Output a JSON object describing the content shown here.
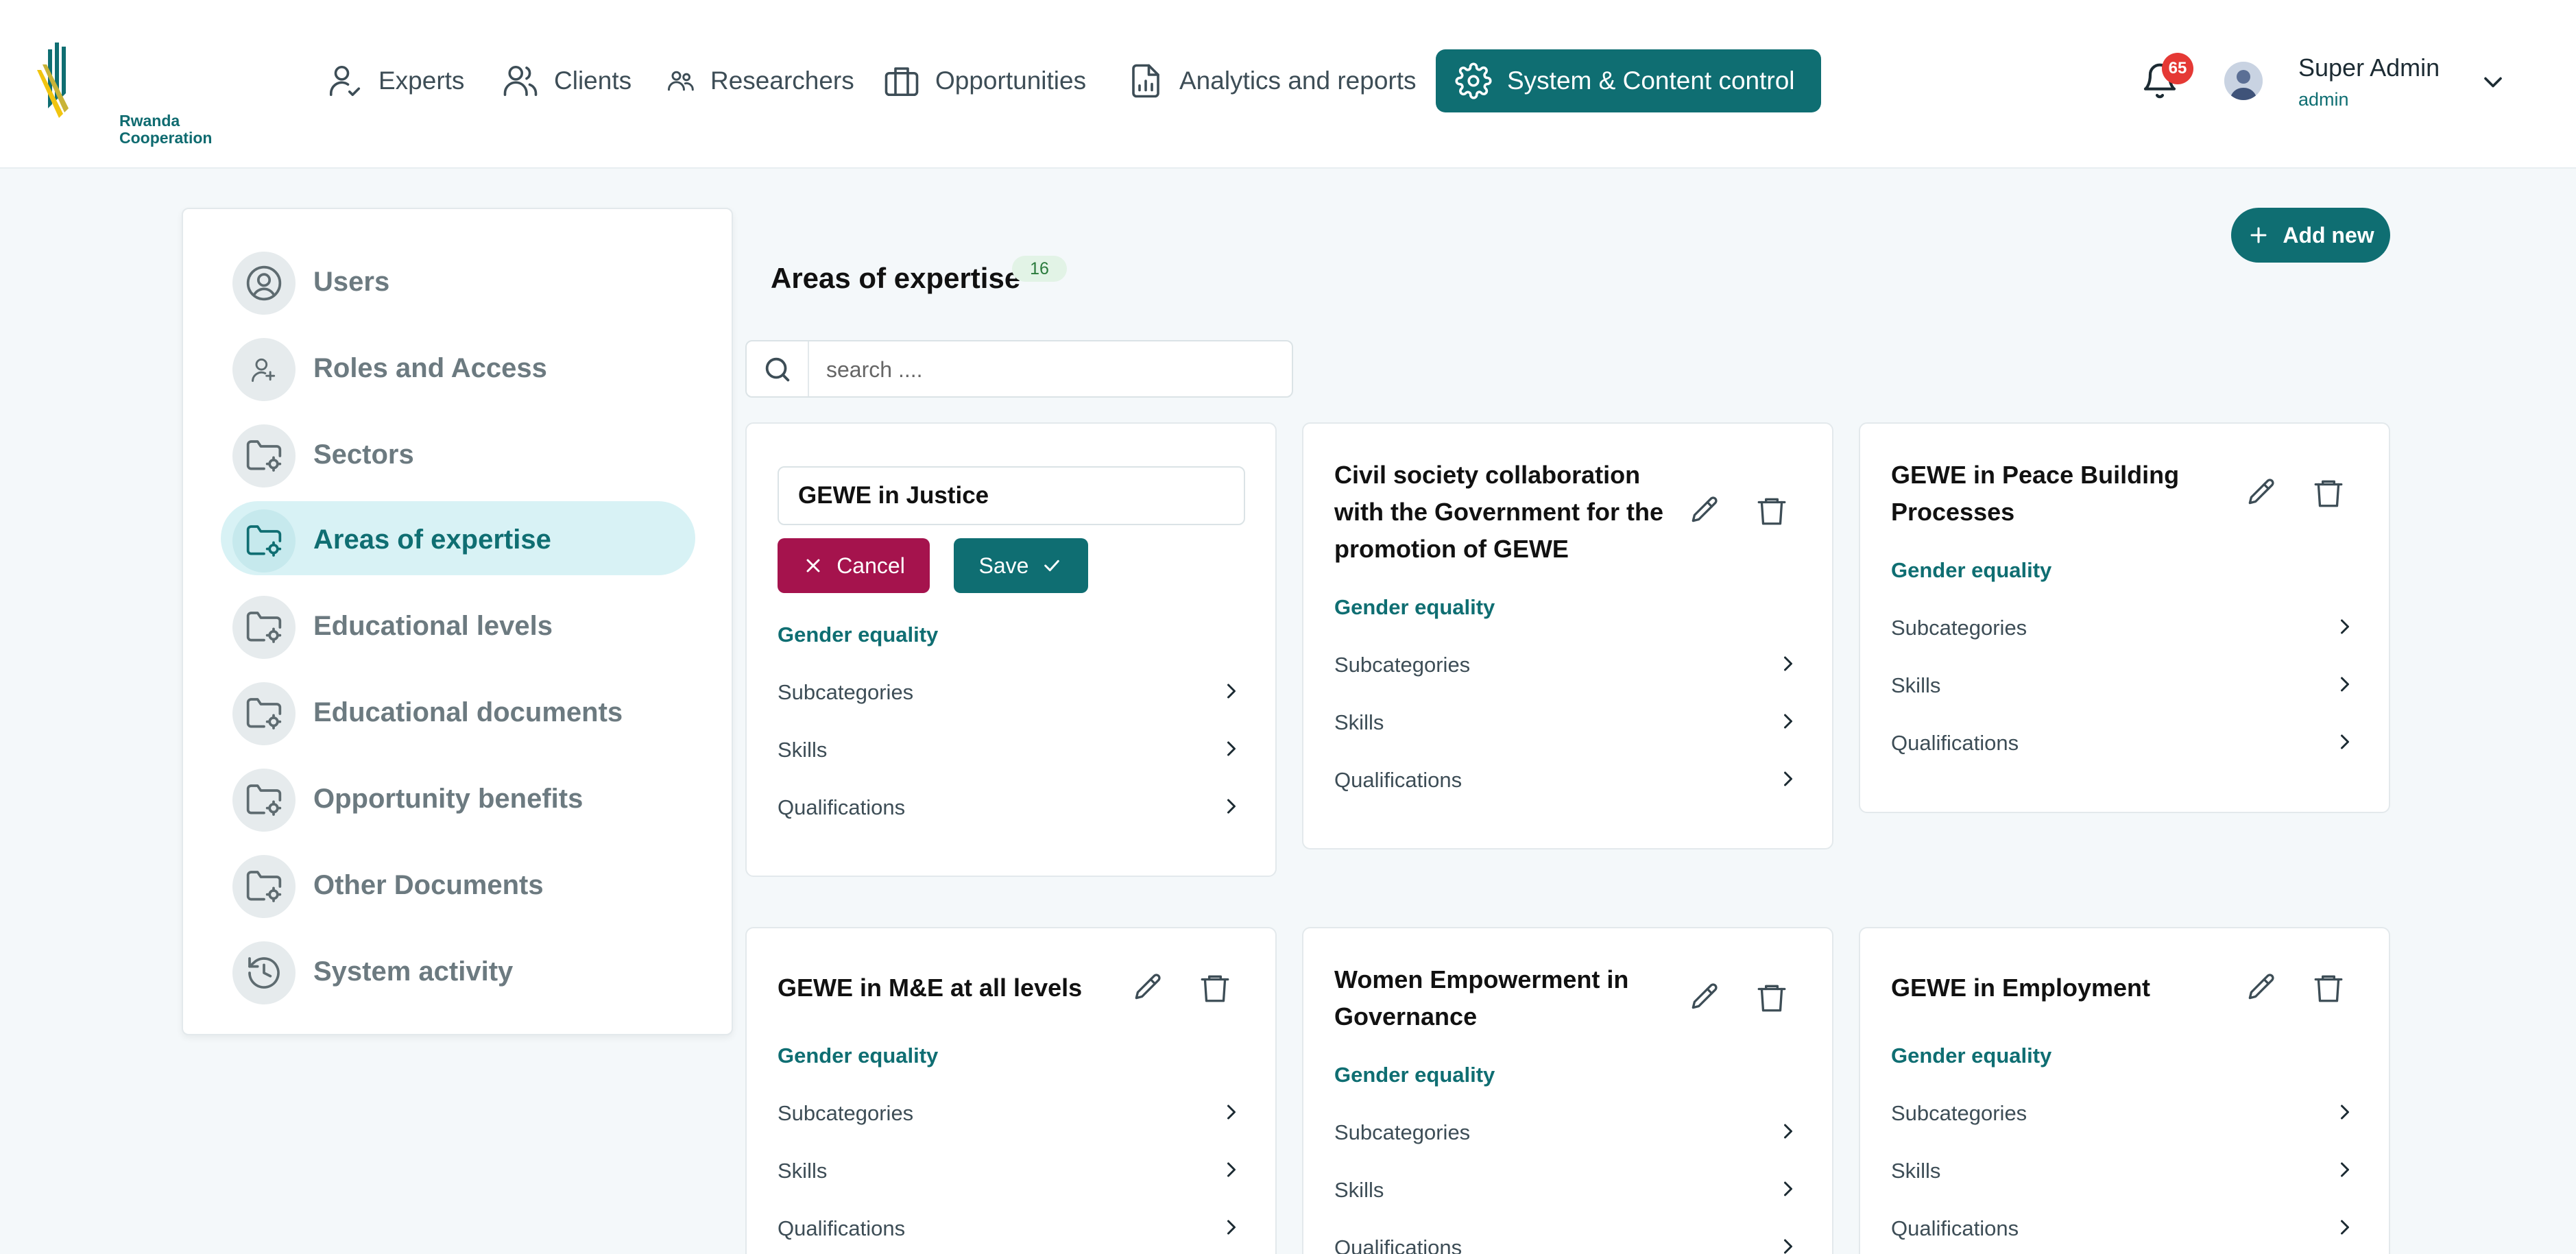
{
  "brand": {
    "line1": "Rwanda",
    "line2": "Cooperation"
  },
  "nav": [
    {
      "label": "Experts",
      "icon": "user-check-icon"
    },
    {
      "label": "Clients",
      "icon": "users-icon"
    },
    {
      "label": "Researchers",
      "icon": "users-small-icon"
    },
    {
      "label": "Opportunities",
      "icon": "briefcase-icon"
    },
    {
      "label": "Analytics and reports",
      "icon": "report-icon"
    },
    {
      "label": "System & Content control",
      "icon": "gear-icon",
      "active": true
    }
  ],
  "notifications": {
    "count": "65"
  },
  "user": {
    "name": "Super Admin",
    "role": "admin"
  },
  "sidebar": {
    "items": [
      {
        "label": "Users",
        "icon": "user-circle-icon"
      },
      {
        "label": "Roles and Access",
        "icon": "user-key-icon"
      },
      {
        "label": "Sectors",
        "icon": "folder-gear-icon"
      },
      {
        "label": "Areas of expertise",
        "icon": "folder-gear-icon",
        "active": true
      },
      {
        "label": "Educational levels",
        "icon": "folder-gear-icon"
      },
      {
        "label": "Educational documents",
        "icon": "folder-gear-icon"
      },
      {
        "label": "Opportunity benefits",
        "icon": "folder-gear-icon"
      },
      {
        "label": "Other Documents",
        "icon": "folder-gear-icon"
      },
      {
        "label": "System activity",
        "icon": "history-icon"
      }
    ]
  },
  "main": {
    "title": "Areas of expertise",
    "count": "16",
    "add_label": "Add new",
    "search": {
      "placeholder": "search ....",
      "value": ""
    },
    "editing": {
      "value": "GEWE in Justice",
      "cancel_label": "Cancel",
      "save_label": "Save",
      "category": "Gender equality",
      "rows": [
        "Subcategories",
        "Skills",
        "Qualifications"
      ]
    },
    "cards": [
      {
        "title": "Civil society collaboration with the Government for the promotion of GEWE",
        "category": "Gender equality",
        "rows": [
          "Subcategories",
          "Skills",
          "Qualifications"
        ]
      },
      {
        "title": "GEWE in Peace Building Processes",
        "category": "Gender equality",
        "rows": [
          "Subcategories",
          "Skills",
          "Qualifications"
        ]
      },
      {
        "title": "GEWE in M&E at all levels",
        "category": "Gender equality",
        "rows": [
          "Subcategories",
          "Skills",
          "Qualifications"
        ]
      },
      {
        "title": "Women Empowerment in Governance",
        "category": "Gender equality",
        "rows": [
          "Subcategories",
          "Skills",
          "Qualifications"
        ]
      },
      {
        "title": "GEWE in Employment",
        "category": "Gender equality",
        "rows": [
          "Subcategories",
          "Skills",
          "Qualifications"
        ]
      }
    ]
  },
  "colors": {
    "primary": "#0f6e72",
    "danger": "#a5134d",
    "badge": "#e53935",
    "active_bg": "#d8f2f5"
  }
}
